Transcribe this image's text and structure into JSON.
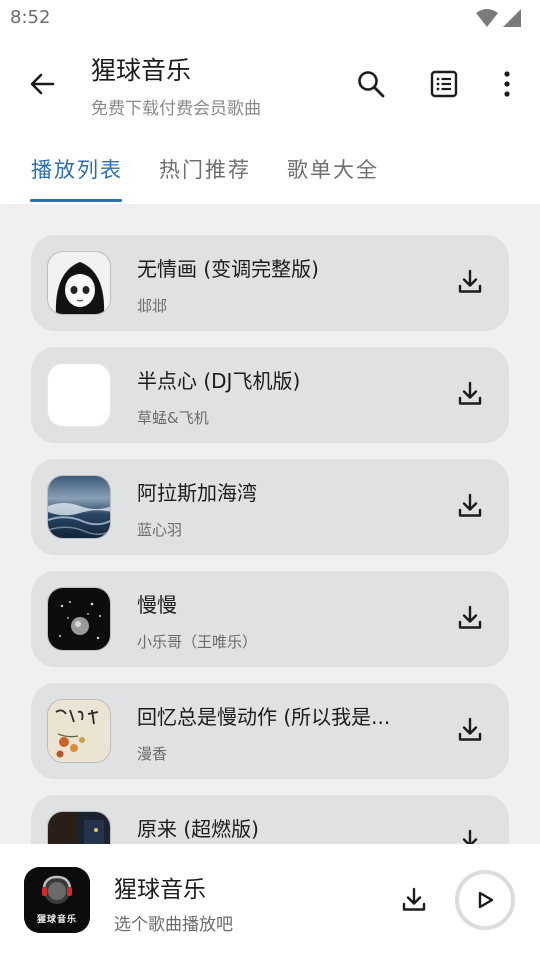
{
  "status_bar": {
    "time": "8:52"
  },
  "app_bar": {
    "title": "猩球音乐",
    "subtitle": "免费下载付费会员歌曲",
    "icons": [
      "back-arrow-icon",
      "search-icon",
      "list-icon",
      "more-vert-icon"
    ]
  },
  "tabs": [
    {
      "label": "播放列表",
      "active": true
    },
    {
      "label": "热门推荐",
      "active": false
    },
    {
      "label": "歌单大全",
      "active": false
    }
  ],
  "songs": [
    {
      "title": "无情画 (变调完整版)",
      "artist": "邶邶",
      "cover": "anime-girl-cover"
    },
    {
      "title": "半点心 (DJ飞机版)",
      "artist": "草蜢&飞机",
      "cover": "blank-white-cover"
    },
    {
      "title": "阿拉斯加海湾",
      "artist": "蓝心羽",
      "cover": "ocean-waves-cover"
    },
    {
      "title": "慢慢",
      "artist": "小乐哥（王唯乐）",
      "cover": "dark-moon-cover"
    },
    {
      "title": "回忆总是慢动作 (所以我是...",
      "artist": "漫香",
      "cover": "calligraphy-flowers-cover"
    },
    {
      "title": "原来 (超燃版)",
      "artist": "",
      "cover": "night-window-cover"
    }
  ],
  "player": {
    "title": "猩球音乐",
    "subtitle": "选个歌曲播放吧",
    "logo_text": "猩球音乐"
  },
  "colors": {
    "accent": "#2f6fad",
    "card": "#e0e1e3",
    "list_background": "#f0f0f0"
  }
}
